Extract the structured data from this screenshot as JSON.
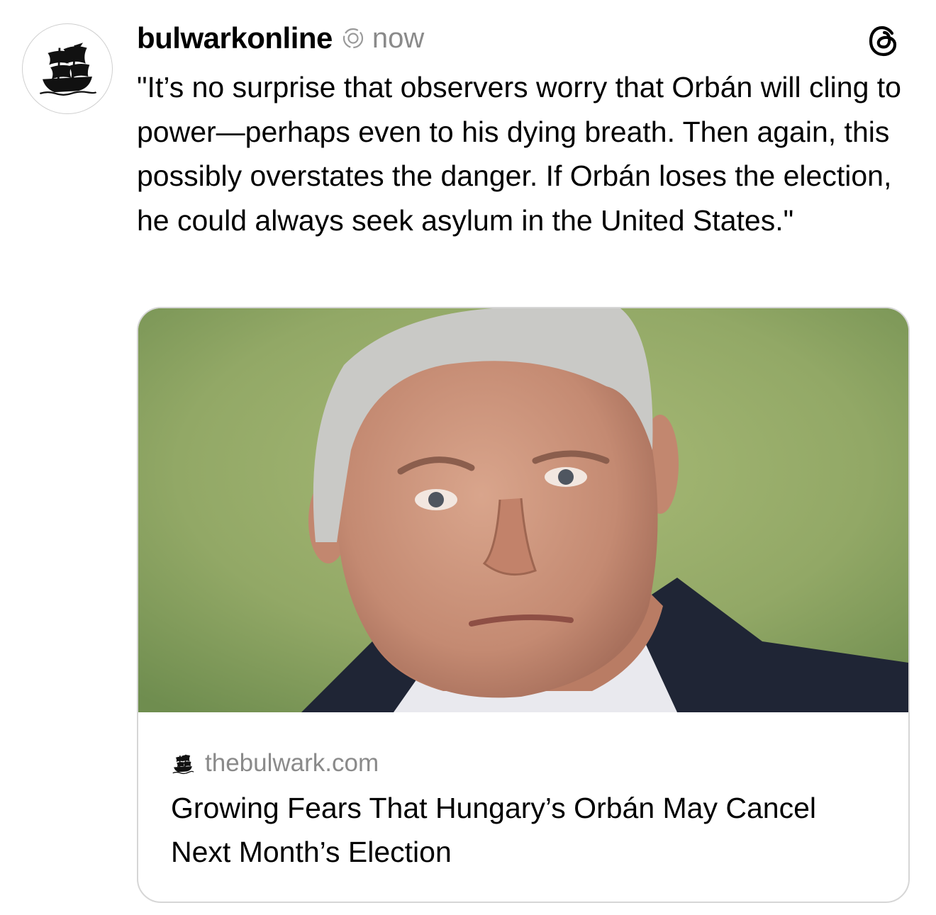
{
  "post": {
    "username": "bulwarkonline",
    "timestamp": "now",
    "text": "\"It’s no surprise that observers worry that Orbán will cling to power—perhaps even to his dying breath. Then again, this possibly overstates the danger. If Orbán loses the election, he could always seek asylum in the United States.\""
  },
  "icons": {
    "avatar": "pirate-ship-logo-icon",
    "repost": "repost-icon",
    "app": "threads-logo-icon",
    "domain_favicon": "pirate-ship-favicon-icon"
  },
  "link_card": {
    "image_alt": "Photo of a man with gray hair in a dark suit against a green background",
    "domain": "thebulwark.com",
    "title": "Growing Fears That Hungary’s Orbán May Cancel Next Month’s Election"
  },
  "colors": {
    "text": "#000000",
    "muted": "#8a8a8a",
    "card_border": "#d6d6d6",
    "background": "#ffffff"
  }
}
